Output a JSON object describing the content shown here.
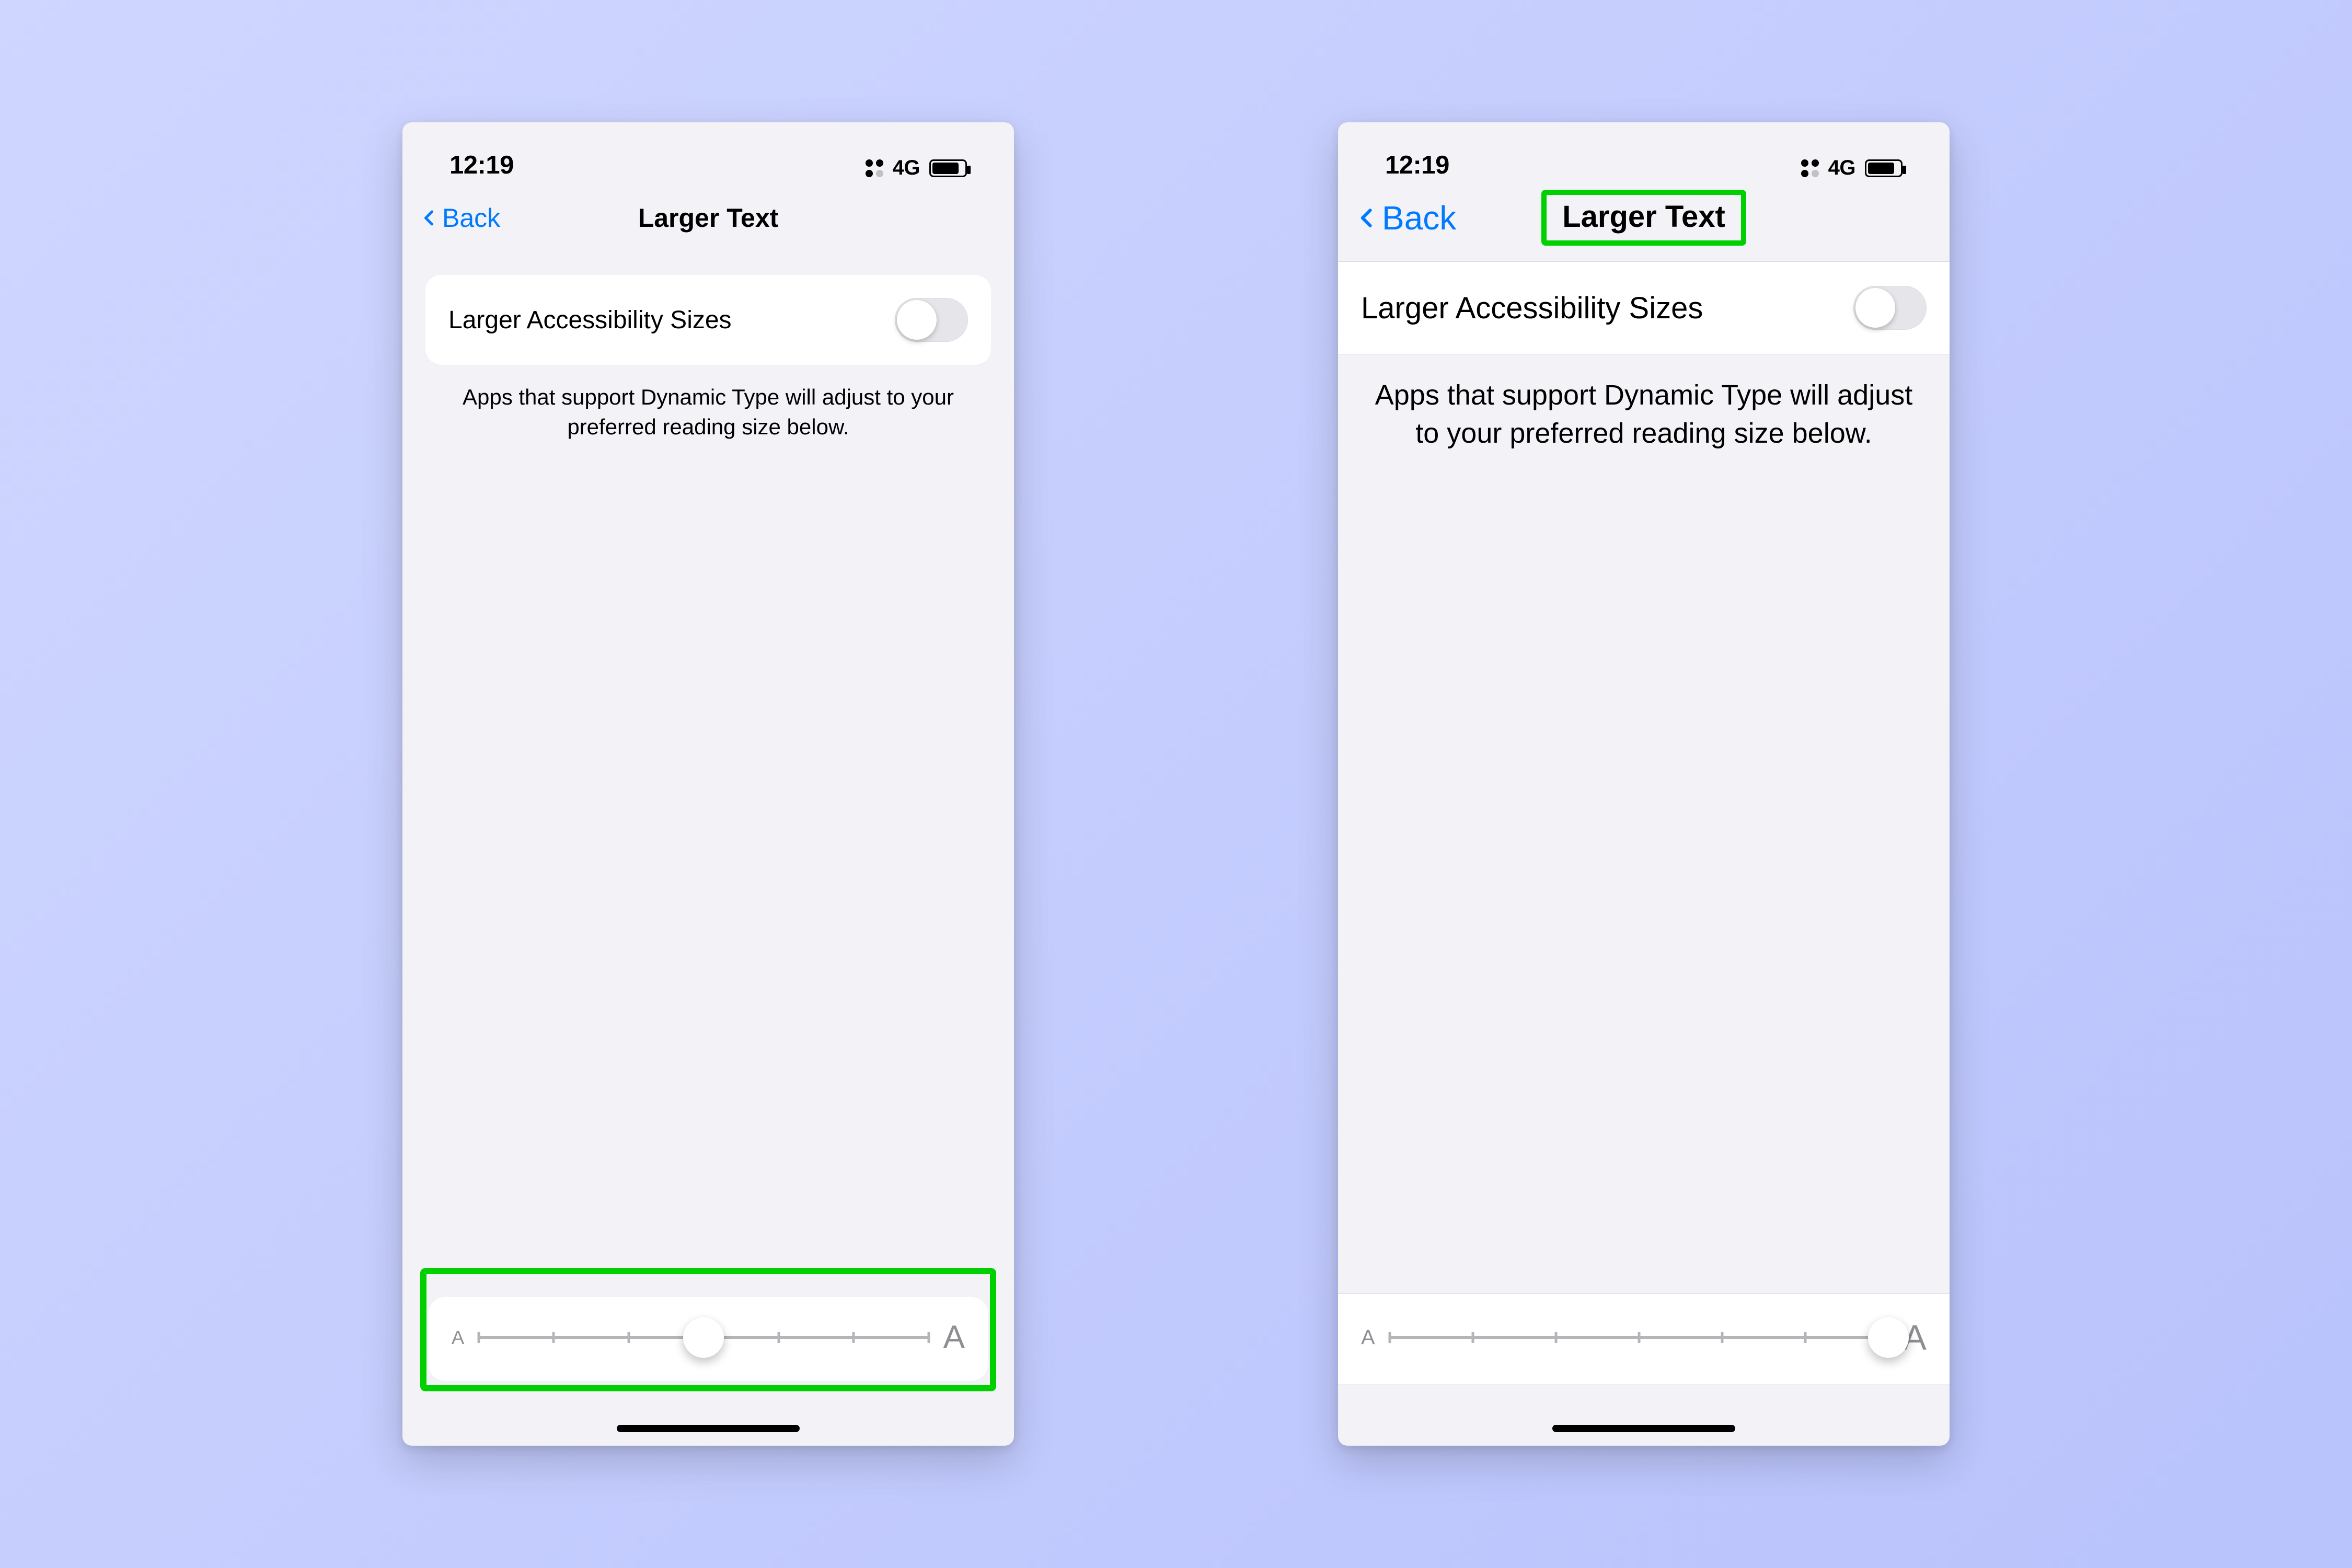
{
  "status": {
    "time": "12:19",
    "network": "4G"
  },
  "nav": {
    "back_label": "Back",
    "title": "Larger Text"
  },
  "settings": {
    "toggle_label": "Larger Accessibility Sizes",
    "toggle_on": false,
    "description": "Apps that support Dynamic Type will adjust to your preferred reading size below."
  },
  "slider": {
    "min_glyph": "A",
    "max_glyph": "A",
    "steps": 7,
    "value_left": 3,
    "value_right": 6
  },
  "colors": {
    "accent_blue": "#007aff",
    "highlight_green": "#00d000"
  }
}
